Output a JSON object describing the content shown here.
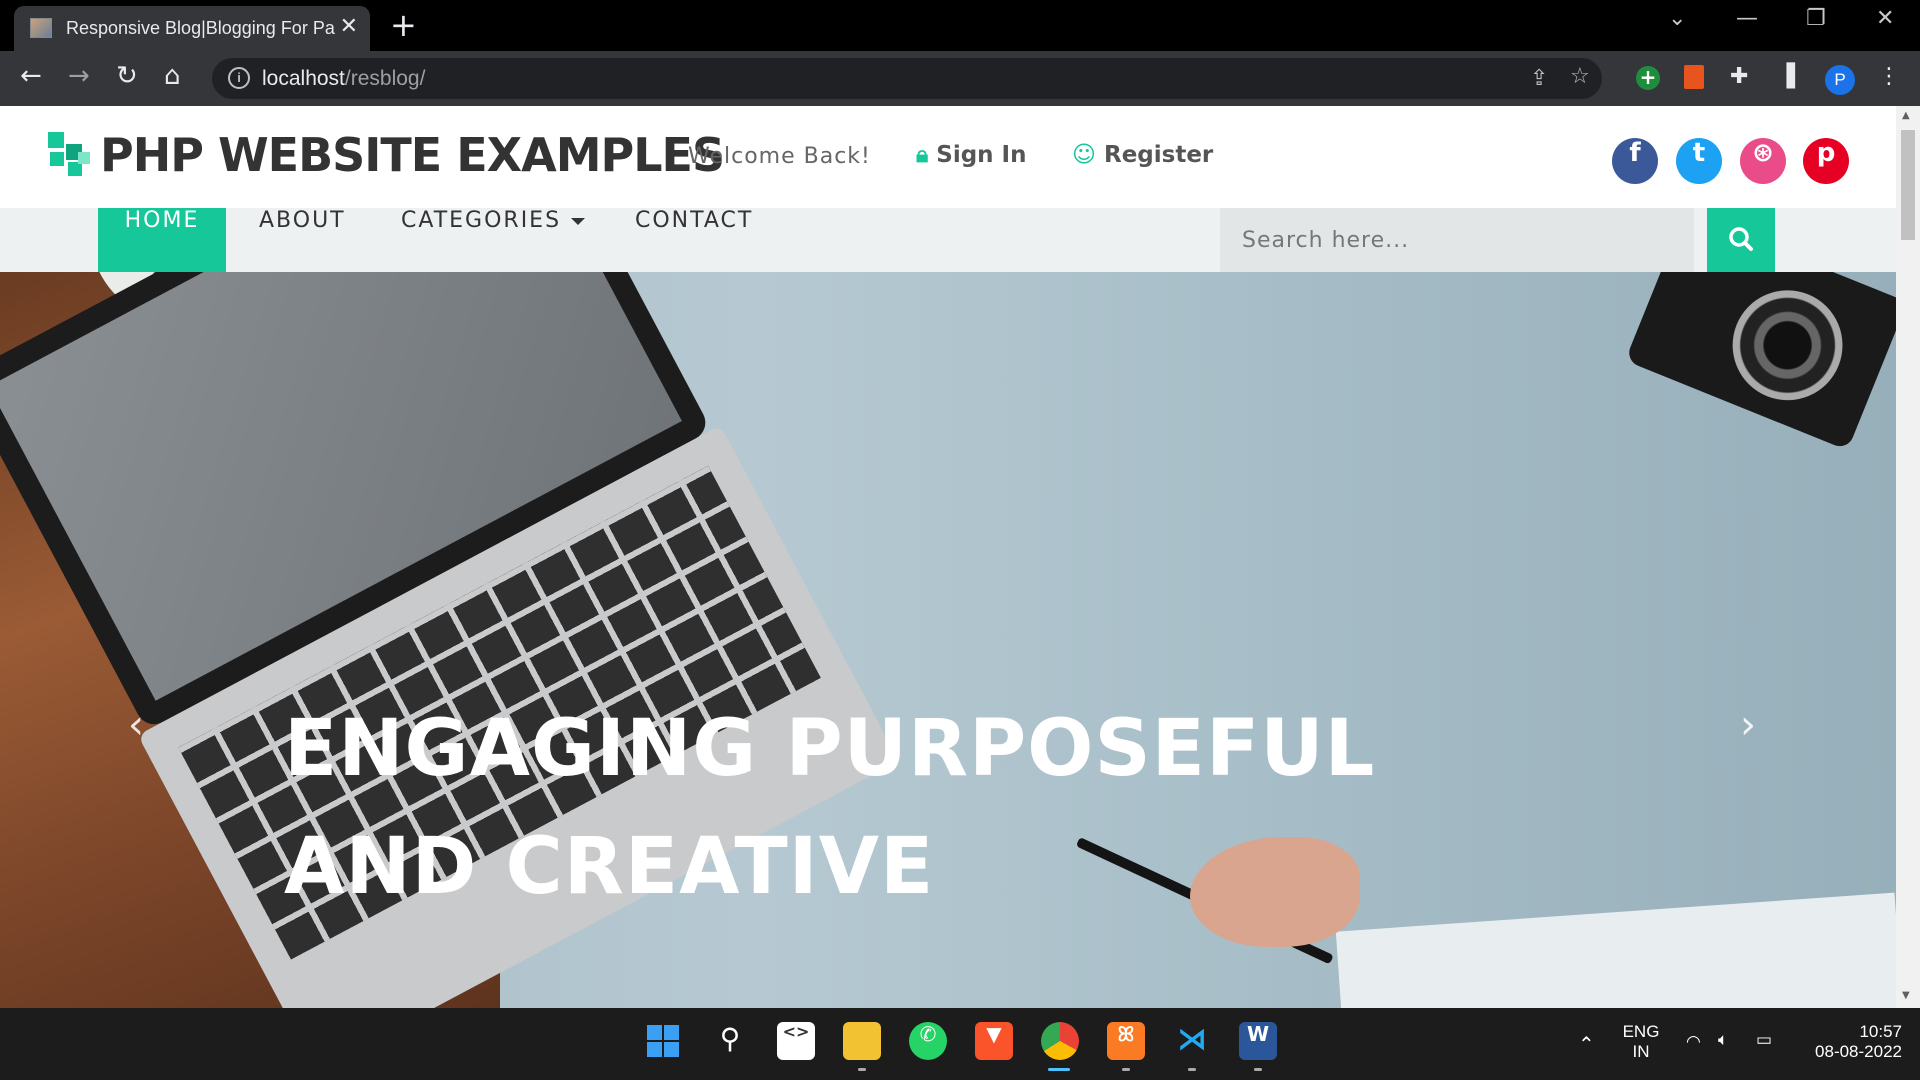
{
  "browser": {
    "tab_title": "Responsive Blog|Blogging For Pa",
    "tab_close": "✕",
    "new_tab": "+",
    "url_host": "localhost",
    "url_path": "/resblog/",
    "profile_initial": "P"
  },
  "site": {
    "logo_text": "PHP WEBSITE EXAMPLES",
    "welcome": "Welcome Back!",
    "sign_in": "Sign In",
    "register": "Register",
    "social": [
      {
        "name": "facebook",
        "glyph": "f",
        "color": "#3b5998"
      },
      {
        "name": "twitter",
        "glyph": "t",
        "color": "#1da1f2"
      },
      {
        "name": "dribbble",
        "glyph": "⊛",
        "color": "#ea4c89"
      },
      {
        "name": "pinterest",
        "glyph": "p",
        "color": "#e60023"
      }
    ]
  },
  "nav": {
    "home": "HOME",
    "about": "ABOUT",
    "categories": "CATEGORIES",
    "contact": "CONTACT",
    "search_placeholder": "Search here..."
  },
  "hero": {
    "line1": "ENGAGING PURPOSEFUL",
    "line2": "AND CREATIVE",
    "prev": "‹",
    "next": "›"
  },
  "system": {
    "lang_line1": "ENG",
    "lang_line2": "IN",
    "time": "10:57",
    "date": "08-08-2022"
  },
  "colors": {
    "accent": "#16c79a",
    "chrome_dark": "#35363a"
  }
}
